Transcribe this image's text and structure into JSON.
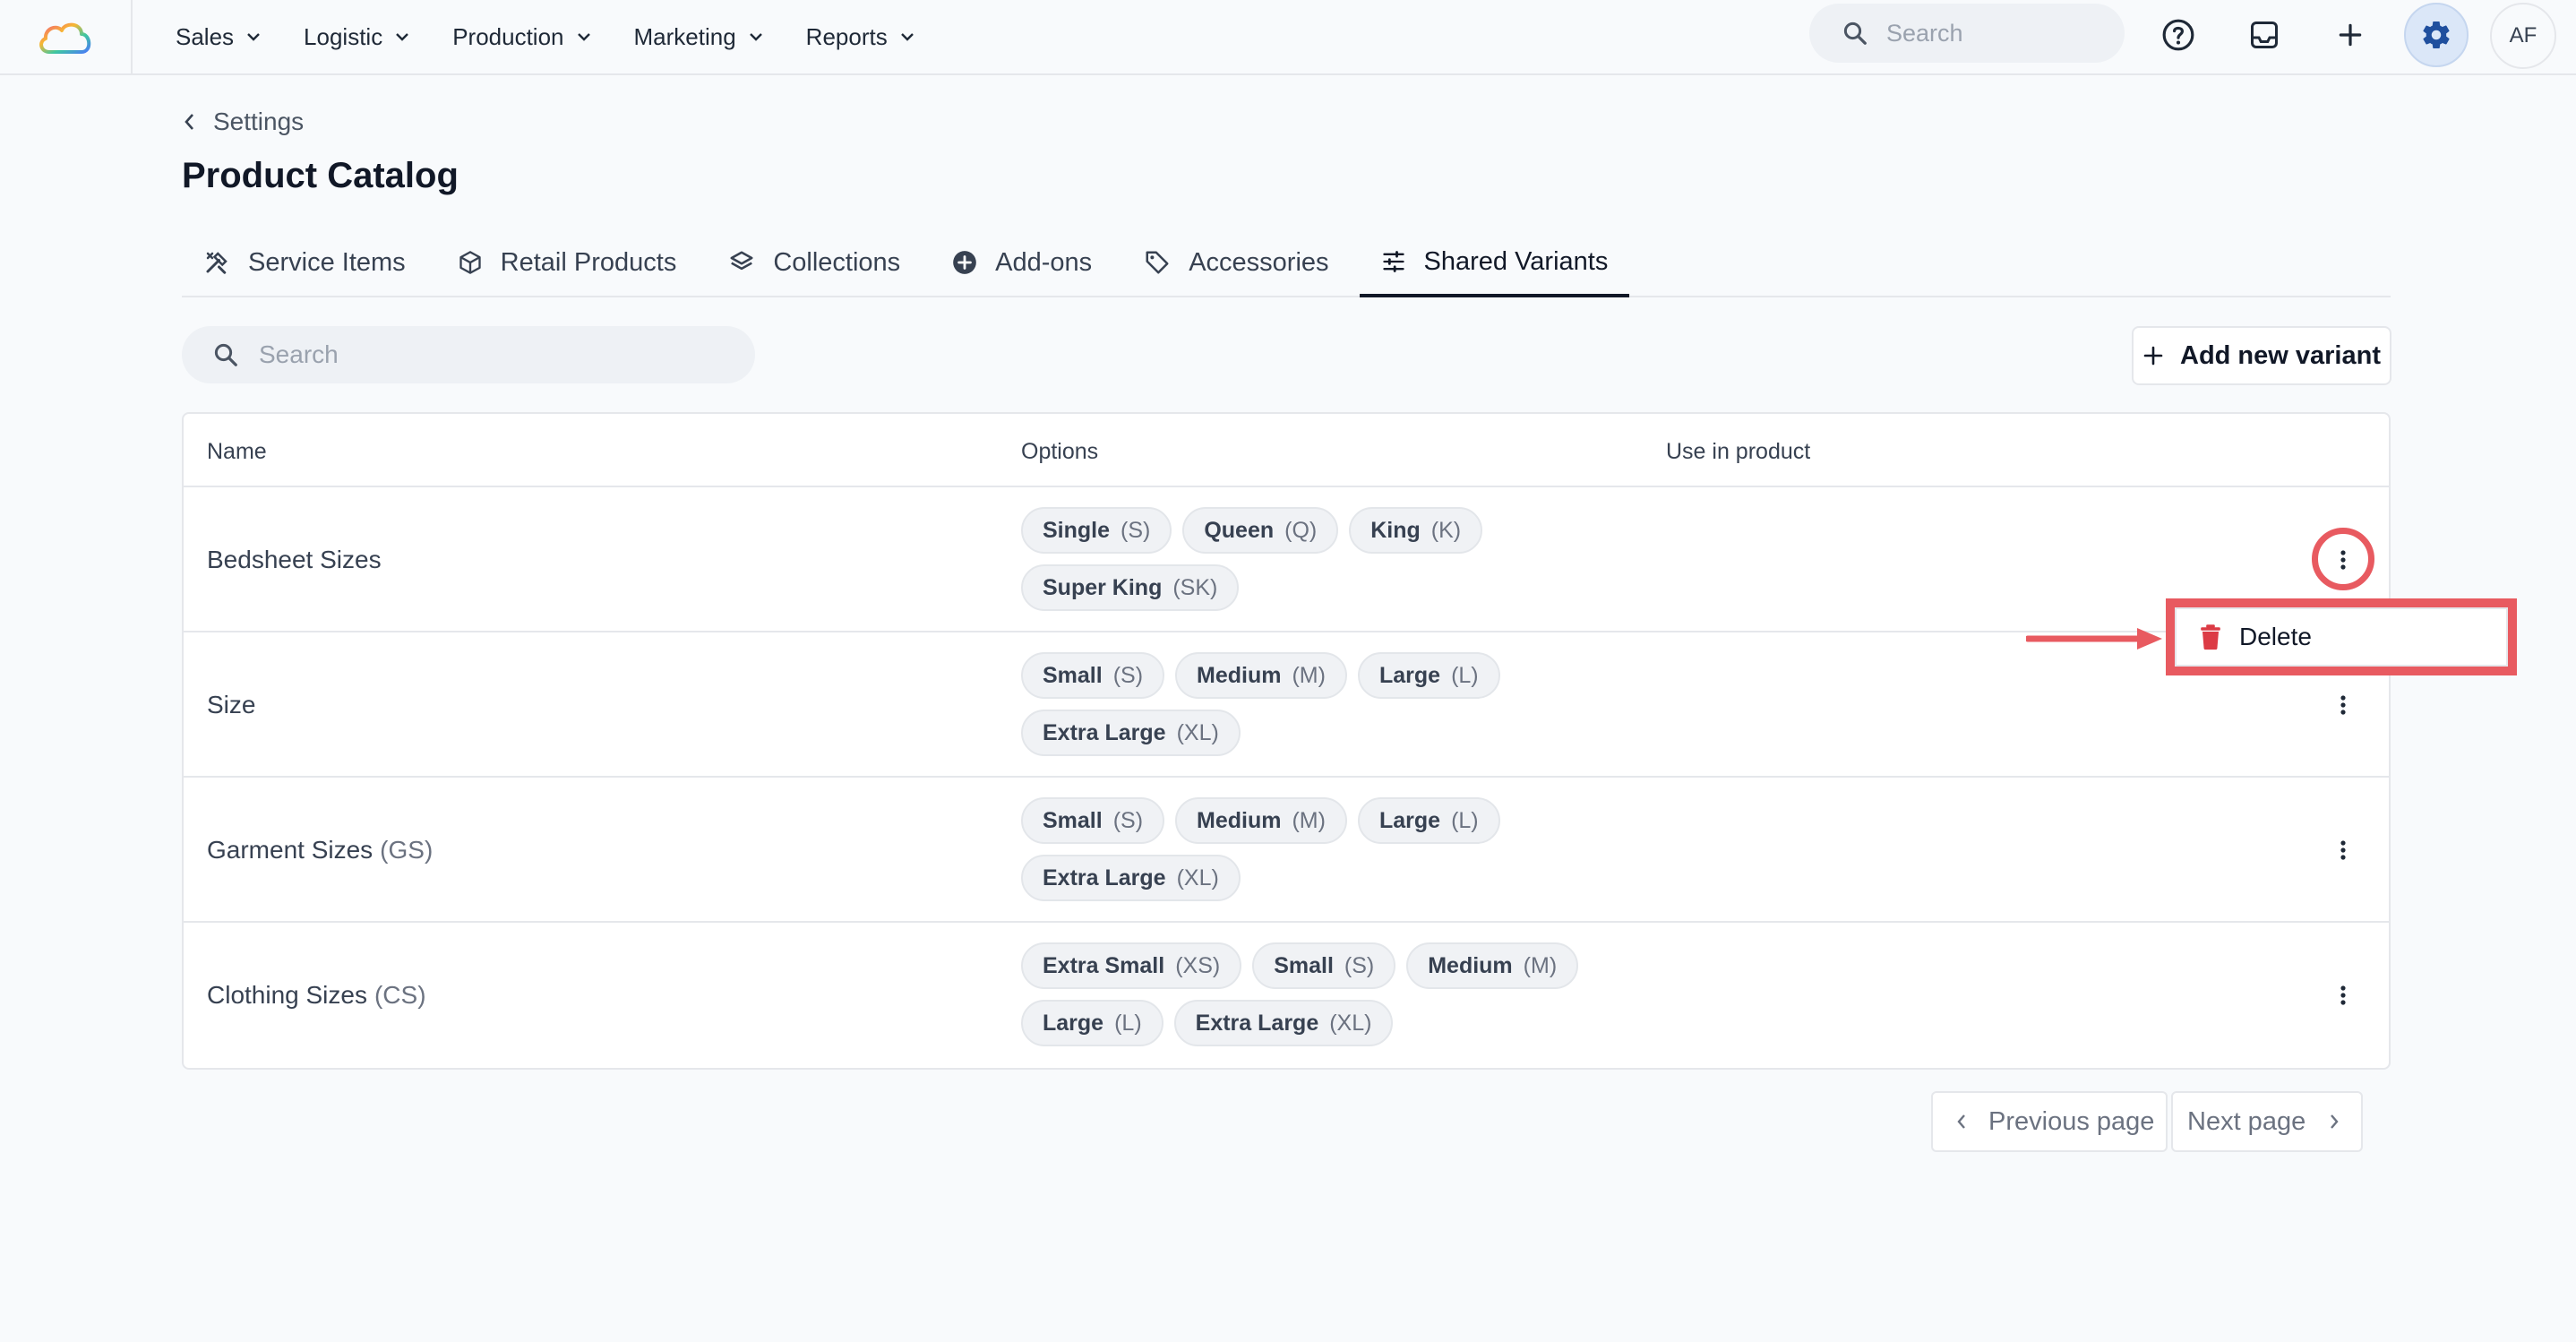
{
  "topnav": {
    "menus": [
      {
        "label": "Sales"
      },
      {
        "label": "Logistic"
      },
      {
        "label": "Production"
      },
      {
        "label": "Marketing"
      },
      {
        "label": "Reports"
      }
    ],
    "search_placeholder": "Search",
    "avatar_initials": "AF"
  },
  "header": {
    "breadcrumb": "Settings",
    "title": "Product Catalog"
  },
  "tabs": [
    {
      "label": "Service Items",
      "icon": "tools-icon"
    },
    {
      "label": "Retail Products",
      "icon": "box-icon"
    },
    {
      "label": "Collections",
      "icon": "layers-icon"
    },
    {
      "label": "Add-ons",
      "icon": "plus-circle-icon"
    },
    {
      "label": "Accessories",
      "icon": "tag-icon"
    },
    {
      "label": "Shared Variants",
      "icon": "sliders-icon",
      "active": true
    }
  ],
  "list": {
    "search_placeholder": "Search",
    "add_button": "Add new variant"
  },
  "table": {
    "columns": {
      "name": "Name",
      "options": "Options",
      "use": "Use in product"
    },
    "rows": [
      {
        "name": "Bedsheet Sizes",
        "abbr": "",
        "options": [
          {
            "label": "Single",
            "code": "(S)"
          },
          {
            "label": "Queen",
            "code": "(Q)"
          },
          {
            "label": "King",
            "code": "(K)"
          },
          {
            "label": "Super King",
            "code": "(SK)"
          }
        ]
      },
      {
        "name": "Size",
        "abbr": "",
        "options": [
          {
            "label": "Small",
            "code": "(S)"
          },
          {
            "label": "Medium",
            "code": "(M)"
          },
          {
            "label": "Large",
            "code": "(L)"
          },
          {
            "label": "Extra Large",
            "code": "(XL)"
          }
        ]
      },
      {
        "name": "Garment Sizes",
        "abbr": "(GS)",
        "options": [
          {
            "label": "Small",
            "code": "(S)"
          },
          {
            "label": "Medium",
            "code": "(M)"
          },
          {
            "label": "Large",
            "code": "(L)"
          },
          {
            "label": "Extra Large",
            "code": "(XL)"
          }
        ]
      },
      {
        "name": "Clothing Sizes",
        "abbr": "(CS)",
        "options": [
          {
            "label": "Extra Small",
            "code": "(XS)"
          },
          {
            "label": "Small",
            "code": "(S)"
          },
          {
            "label": "Medium",
            "code": "(M)"
          },
          {
            "label": "Large",
            "code": "(L)"
          },
          {
            "label": "Extra Large",
            "code": "(XL)"
          }
        ]
      }
    ]
  },
  "row_menu": {
    "delete_label": "Delete"
  },
  "pagination": {
    "prev": "Previous page",
    "next": "Next page"
  },
  "colors": {
    "highlight": "#e85a60",
    "delete_icon": "#dc3b45",
    "gear_accent": "#1f4f9e"
  }
}
